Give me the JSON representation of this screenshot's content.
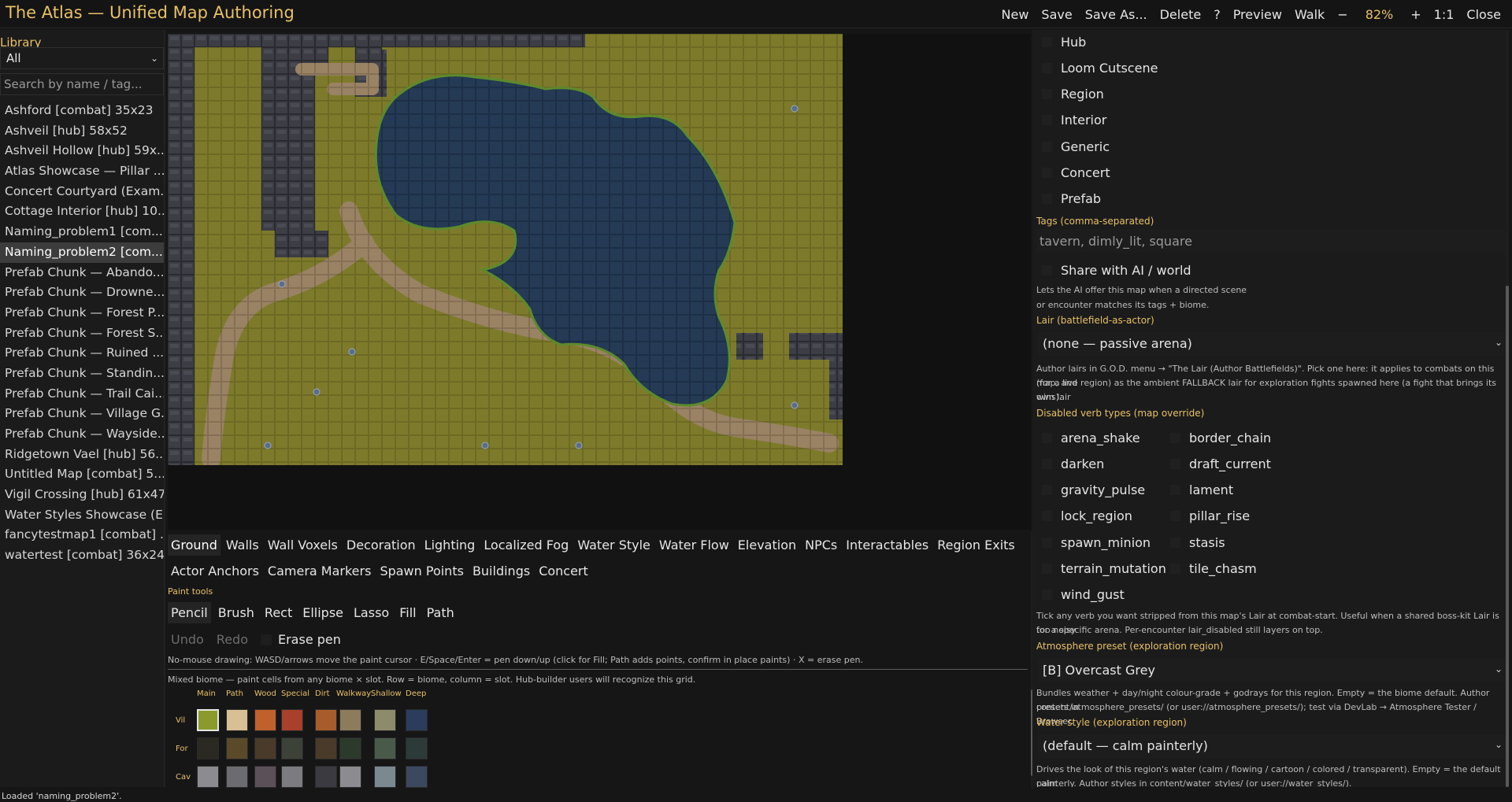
{
  "app": {
    "title": "The Atlas  —  Unified Map Authoring"
  },
  "toolbar": {
    "buttons": [
      "New",
      "Save",
      "Save As...",
      "Delete",
      "?",
      "Preview",
      "Walk",
      "−",
      "82%",
      "+",
      "1:1",
      "Close"
    ]
  },
  "library": {
    "title": "Library",
    "filter_value": "All",
    "search_placeholder": "Search by name / tag...",
    "items": [
      "Ashford  [combat] 35x23",
      "Ashveil  [hub] 58x52",
      "Ashveil Hollow  [hub] 59x...",
      "Atlas Showcase — Pillar ...",
      "Concert Courtyard (Exam...",
      "Cottage Interior  [hub] 10...",
      "Naming_problem1  [com...",
      "Naming_problem2  [com...",
      "Prefab Chunk — Abando...",
      "Prefab Chunk — Drowne...",
      "Prefab Chunk — Forest P...",
      "Prefab Chunk — Forest S...",
      "Prefab Chunk — Ruined ...",
      "Prefab Chunk — Standin...",
      "Prefab Chunk — Trail Cai...",
      "Prefab Chunk — Village G...",
      "Prefab Chunk — Wayside...",
      "Ridgetown Vael  [hub] 56...",
      "Untitled Map  [combat] 5...",
      "Vigil Crossing  [hub] 61x47",
      "Water Styles Showcase (E...",
      "fancytestmap1  [combat] ...",
      "watertest  [combat] 36x24"
    ],
    "selected_index": 7
  },
  "layers": {
    "row1": [
      "Ground",
      "Walls",
      "Wall Voxels",
      "Decoration",
      "Lighting",
      "Localized Fog",
      "Water Style",
      "Water Flow",
      "Elevation",
      "NPCs",
      "Interactables",
      "Region Exits"
    ],
    "row2": [
      "Actor Anchors",
      "Camera Markers",
      "Spawn Points",
      "Buildings",
      "Concert"
    ],
    "active": "Ground"
  },
  "paint": {
    "label": "Paint tools",
    "tools": [
      "Pencil",
      "Brush",
      "Rect",
      "Ellipse",
      "Lasso",
      "Fill",
      "Path"
    ],
    "active": "Pencil",
    "undo": "Undo",
    "redo": "Redo",
    "erase": "Erase pen",
    "hint": "No-mouse drawing: WASD/arrows move the paint cursor · E/Space/Enter = pen down/up (click for Fill; Path adds points, confirm in place paints) · X = erase pen.",
    "biome_note": "Mixed biome — paint cells from any biome × slot. Row = biome, column = slot. Hub-builder users will recognize this grid.",
    "columns": [
      "Main",
      "Path",
      "Wood",
      "Special",
      "Dirt",
      "Walkway",
      "Shallow",
      "Deep"
    ],
    "rows": [
      "Vil",
      "For",
      "Cav"
    ],
    "swatch_colors": [
      [
        "#8a9a2c",
        "#d8c094",
        "#c0602c",
        "#a8402c",
        "#a85c2c",
        "#8c7c5c",
        "#8c8c6c",
        "#2c3c5c"
      ],
      [
        "#2a2a22",
        "#5a4a2a",
        "#4a3a2a",
        "#3c4238",
        "#4a3a2a",
        "#2c3a2c",
        "#4a5a4a",
        "#2c3a38"
      ],
      [
        "#8c8c90",
        "#6c6c70",
        "#5c5058",
        "#7c7c80",
        "#3a3a40",
        "#8c8c90",
        "#7c8890",
        "#3c4860"
      ]
    ]
  },
  "props": {
    "type_options": [
      "Hub",
      "Loom Cutscene",
      "Region",
      "Interior",
      "Generic",
      "Concert",
      "Prefab"
    ],
    "tags_label": "Tags (comma-separated)",
    "tags_placeholder": "tavern, dimly_lit, square",
    "share_label": "Share with AI / world",
    "share_note_1": "Lets the AI offer this map when a directed scene",
    "share_note_2": "or encounter matches its tags + biome.",
    "lair_label": "Lair (battlefield-as-actor)",
    "lair_value": "(none — passive arena)",
    "lair_note_1": "Author lairs in G.O.D. menu → \"The Lair (Author Battlefields)\". Pick one here: it applies to combats on this map, and",
    "lair_note_2": "(for a live region) as the ambient FALLBACK lair for exploration fights spawned here (a fight that brings its own lair",
    "lair_note_3": "wins).",
    "verbs_label": "Disabled verb types (map override)",
    "verbs": [
      "arena_shake",
      "border_chain",
      "darken",
      "draft_current",
      "gravity_pulse",
      "lament",
      "lock_region",
      "pillar_rise",
      "spawn_minion",
      "stasis",
      "terrain_mutation",
      "tile_chasm",
      "wind_gust"
    ],
    "verbs_note_1": "Tick any verb you want stripped from this map's Lair at combat-start. Useful when a shared boss-kit Lair is too noisy",
    "verbs_note_2": "for a specific arena. Per-encounter lair_disabled still layers on top.",
    "atmo_label": "Atmosphere preset (exploration region)",
    "atmo_value": "[B] Overcast Grey",
    "atmo_note_1": "Bundles weather + day/night colour-grade + godrays for this region. Empty = the biome default. Author presets in",
    "atmo_note_2": "content/atmosphere_presets/ (or user://atmosphere_presets/); test via DevLab → Atmosphere Tester / Browser.",
    "water_label": "Water style (exploration region)",
    "water_value": "(default — calm painterly)",
    "water_note_1": "Drives the look of this region's water (calm / flowing / cartoon / colored / transparent). Empty = the default calm",
    "water_note_2": "painterly. Author styles in content/water_styles/ (or user://water_styles/)."
  },
  "status": {
    "text": "Loaded 'naming_problem2'."
  },
  "colors": {
    "accent": "#e8c068",
    "grass": "#7f7d2c",
    "water": "#253a55",
    "path": "#9c8466",
    "wall": "#3a3a42"
  }
}
